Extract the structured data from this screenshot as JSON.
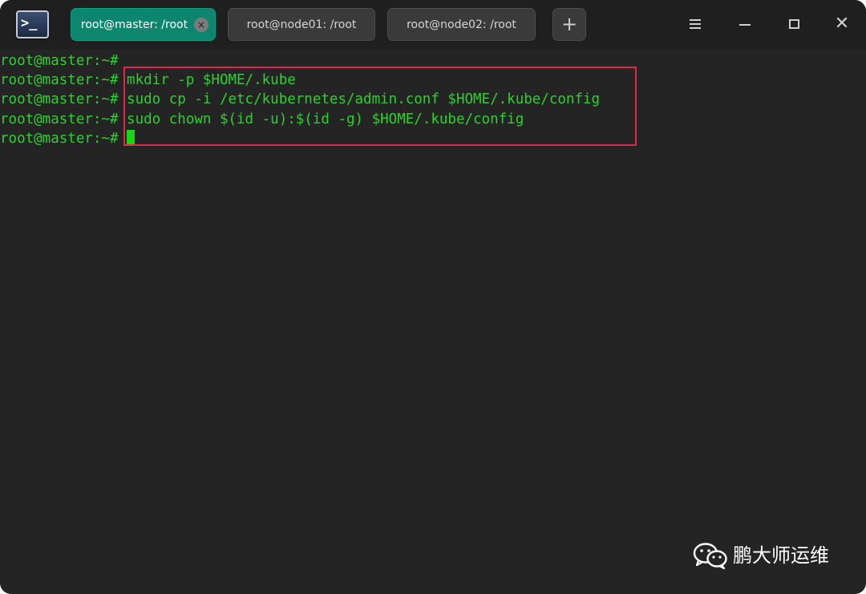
{
  "tabs": [
    {
      "label": "root@master: /root",
      "active": true,
      "close": "×"
    },
    {
      "label": "root@node01: /root",
      "active": false
    },
    {
      "label": "root@node02: /root",
      "active": false
    }
  ],
  "add_tab": "+",
  "window_controls": {
    "close": "✕"
  },
  "app_icon_text": ">_",
  "terminal": {
    "prompt": "root@master:~#",
    "lines": [
      {
        "prompt": "root@master:~#",
        "cmd": ""
      },
      {
        "prompt": "root@master:~#",
        "cmd": " mkdir -p $HOME/.kube"
      },
      {
        "prompt": "root@master:~#",
        "cmd": " sudo cp -i /etc/kubernetes/admin.conf $HOME/.kube/config"
      },
      {
        "prompt": "root@master:~#",
        "cmd": " sudo chown $(id -u):$(id -g) $HOME/.kube/config"
      },
      {
        "prompt": "root@master:~#",
        "cmd": " "
      }
    ]
  },
  "watermark": "鹏大师运维",
  "colors": {
    "terminal_text": "#2fcf2f",
    "highlight": "#e3264c",
    "active_tab": "#0d8670"
  }
}
